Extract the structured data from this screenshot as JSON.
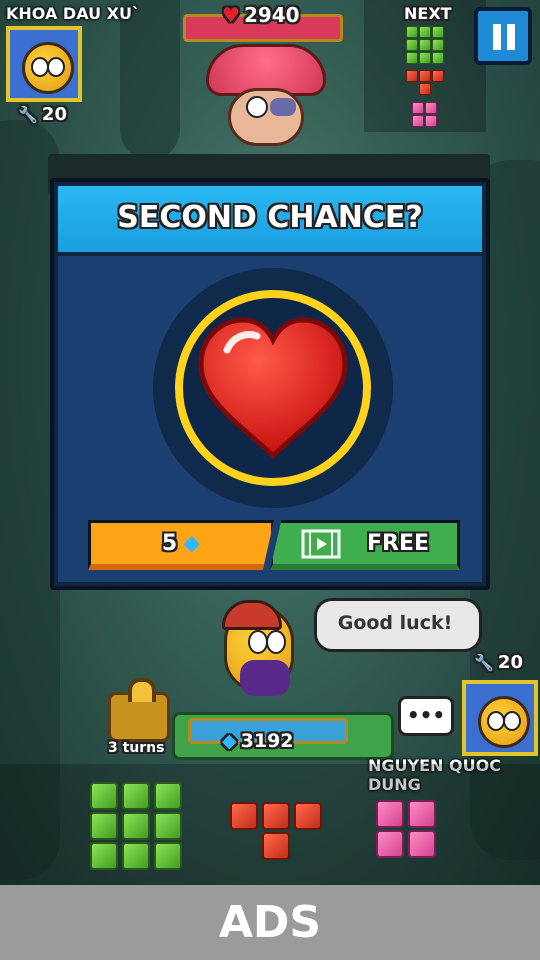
{
  "opponent": {
    "name": "KHOA DAU XU`",
    "score": "20"
  },
  "boss": {
    "hp": "2940"
  },
  "next": {
    "label": "NEXT"
  },
  "pause": {
    "icon": "pause-icon"
  },
  "modal": {
    "title": "SECOND CHANCE?",
    "gem_cost": "5",
    "free_label": "FREE"
  },
  "player": {
    "speech": "Good luck!",
    "gems": "3192",
    "name": "NGUYEN QUOC DUNG",
    "score": "20"
  },
  "lock": {
    "turns": "3 turns"
  },
  "ads": {
    "label": "ADS"
  },
  "colors": {
    "accent": "#1a9ee0",
    "gem_button": "#ffa416",
    "free_button": "#3fae4f",
    "ring": "#ffd21c"
  }
}
